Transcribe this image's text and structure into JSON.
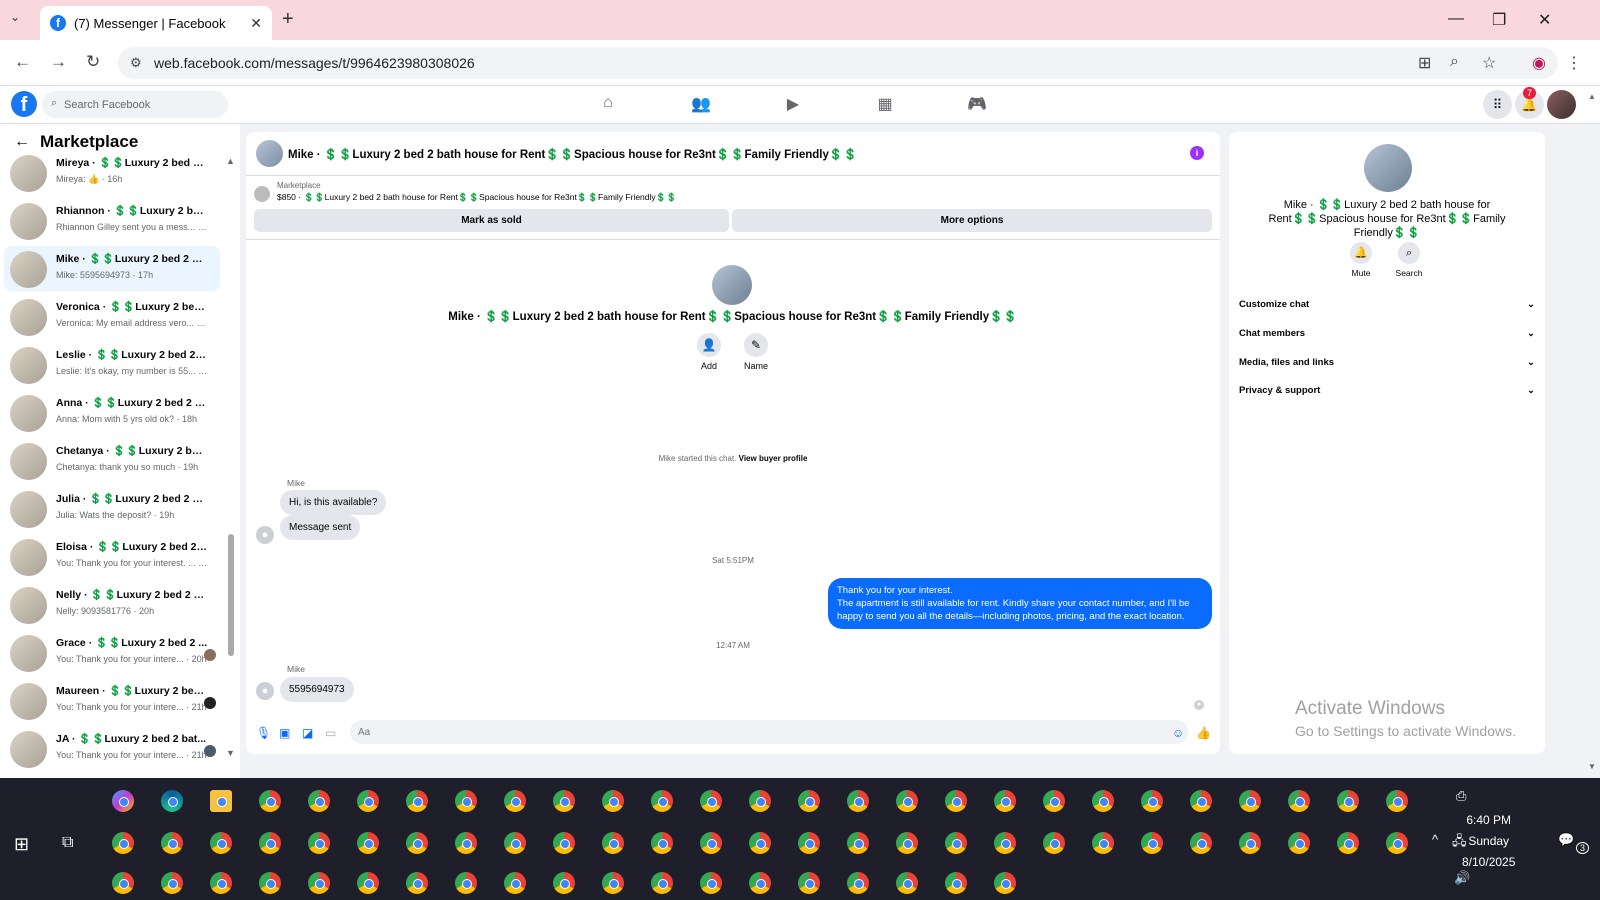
{
  "browser": {
    "tab_title": "(7) Messenger | Facebook",
    "url": "web.facebook.com/messages/t/9964623980308026"
  },
  "facebook": {
    "search_placeholder": "Search Facebook",
    "notifications_count": "7"
  },
  "sidebar": {
    "heading": "Marketplace",
    "conversations": [
      {
        "name": "Mireya · 💲💲Luxury 2 bed 2 b...",
        "preview": "Mireya: 👍 · 16h"
      },
      {
        "name": "Rhiannon · 💲💲Luxury 2 bed ...",
        "preview": "Rhiannon Gilley sent you a mess... · 17h"
      },
      {
        "name": "Mike · 💲💲Luxury 2 bed 2 bat...",
        "preview": "Mike: 5595694973 · 17h"
      },
      {
        "name": "Veronica · 💲💲Luxury 2 bed 2 ...",
        "preview": "Veronica: My email address vero... · 18h"
      },
      {
        "name": "Leslie · 💲💲Luxury 2 bed 2 bat...",
        "preview": "Leslie: It's okay, my number is 55... · 18h"
      },
      {
        "name": "Anna · 💲💲Luxury 2 bed 2 bat...",
        "preview": "Anna: Mom with 5 yrs old ok? · 18h"
      },
      {
        "name": "Chetanya · 💲💲Luxury 2 bed 2...",
        "preview": "Chetanya: thank you so much · 19h"
      },
      {
        "name": "Julia · 💲💲Luxury 2 bed 2 bat...",
        "preview": "Julia: Wats the deposit? · 19h"
      },
      {
        "name": "Eloisa · 💲💲Luxury 2 bed 2 ba...",
        "preview": "You: Thank you for your interest. ... · 19h"
      },
      {
        "name": "Nelly · 💲💲Luxury 2 bed 2 bat...",
        "preview": "Nelly: 9093581776 · 20h"
      },
      {
        "name": "Grace · 💲💲Luxury 2 bed 2 ...",
        "preview": "You: Thank you for your intere... · 20h"
      },
      {
        "name": "Maureen · 💲💲Luxury 2 bed...",
        "preview": "You: Thank you for your intere... · 21h"
      },
      {
        "name": "JA · 💲💲Luxury 2 bed 2 bat...",
        "preview": "You: Thank you for your intere... · 21h"
      }
    ]
  },
  "chat": {
    "title": "Mike · 💲💲Luxury 2 bed 2 bath house for Rent💲💲Spacious house for Re3nt💲💲Family Friendly💲💲",
    "listing_label": "Marketplace",
    "listing_price": "$850 · 💲💲Luxury 2 bed 2 bath house for Rent💲💲Spacious house for Re3nt💲💲Family Friendly💲💲",
    "mark_sold": "Mark as sold",
    "more_options": "More options",
    "add_label": "Add",
    "name_label": "Name",
    "started_text": "Mike started this chat.",
    "view_profile": "View buyer profile",
    "sender1": "Mike",
    "msg1": "Hi, is this available?",
    "msg2": "Message sent",
    "stamp1": "Sat 5:51PM",
    "out_line1": "Thank you for your interest.",
    "out_line2": "The apartment is still available for rent. Kindly share your contact number, and I'll be happy to send you all the details—including photos, pricing, and the exact location.",
    "stamp2": "12:47 AM",
    "sender2": "Mike",
    "msg3": "5595694973",
    "input_placeholder": "Aa"
  },
  "details": {
    "title": "Mike · 💲💲Luxury 2 bed 2 bath house for Rent💲💲Spacious house for Re3nt💲💲Family Friendly💲💲",
    "mute": "Mute",
    "search": "Search",
    "sections": [
      "Customize chat",
      "Chat members",
      "Media, files and links",
      "Privacy & support"
    ]
  },
  "watermark": {
    "line1": "Activate Windows",
    "line2": "Go to Settings to activate Windows."
  },
  "taskbar": {
    "time": "6:40 PM",
    "day": "Sunday",
    "date": "8/10/2025",
    "notif_count": "3"
  }
}
